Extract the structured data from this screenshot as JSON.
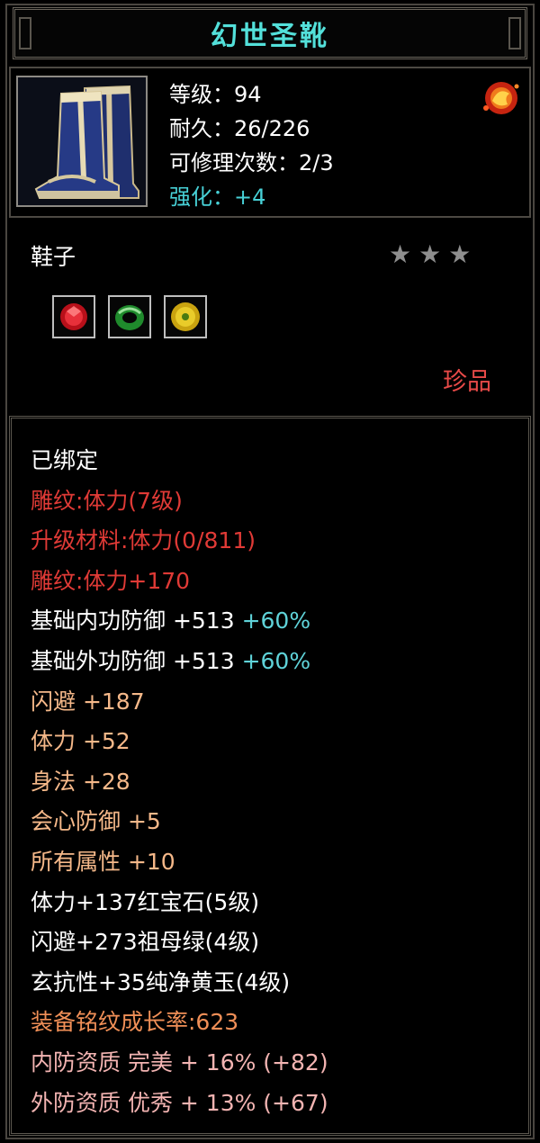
{
  "title": "幻世圣靴",
  "header": {
    "rows": [
      {
        "label": "等级：",
        "value": "94",
        "color": "#ffffff"
      },
      {
        "label": "耐久：",
        "value": "26/226",
        "color": "#ffffff"
      },
      {
        "label": "可修理次数：",
        "value": "2/3",
        "color": "#ffffff"
      },
      {
        "label": "强化：",
        "value": "+4",
        "color": "#47d0d6"
      }
    ]
  },
  "item_type": "鞋子",
  "stars": 3,
  "sockets": [
    "red-gem-icon",
    "green-jade-icon",
    "yellow-jade-icon"
  ],
  "quality": "珍品",
  "attributes": [
    {
      "text": "已绑定",
      "cls": "white"
    },
    {
      "text": "雕纹:体力(7级)",
      "cls": "red"
    },
    {
      "text": "升级材料:体力(0/811)",
      "cls": "red"
    },
    {
      "text": "雕纹:体力+170",
      "cls": "red"
    },
    {
      "text": "基础内功防御  +513",
      "extra": "+60%",
      "cls": "white"
    },
    {
      "text": "基础外功防御  +513",
      "extra": "+60%",
      "cls": "white"
    },
    {
      "text": "闪避  +187",
      "cls": "orange"
    },
    {
      "text": "体力  +52",
      "cls": "orange"
    },
    {
      "text": "身法  +28",
      "cls": "orange"
    },
    {
      "text": "会心防御  +5",
      "cls": "orange"
    },
    {
      "text": "所有属性  +10",
      "cls": "orange"
    },
    {
      "text": "体力+137红宝石(5级)",
      "cls": "white"
    },
    {
      "text": "闪避+273祖母绿(4级)",
      "cls": "white"
    },
    {
      "text": "玄抗性+35纯净黄玉(4级)",
      "cls": "white"
    },
    {
      "text": "装备铭纹成长率:623",
      "cls": "orange-red"
    },
    {
      "text": "内防资质  完美  +  16% (+82)",
      "cls": "pink"
    },
    {
      "text": "外防资质  优秀  +  13% (+67)",
      "cls": "pink"
    }
  ]
}
